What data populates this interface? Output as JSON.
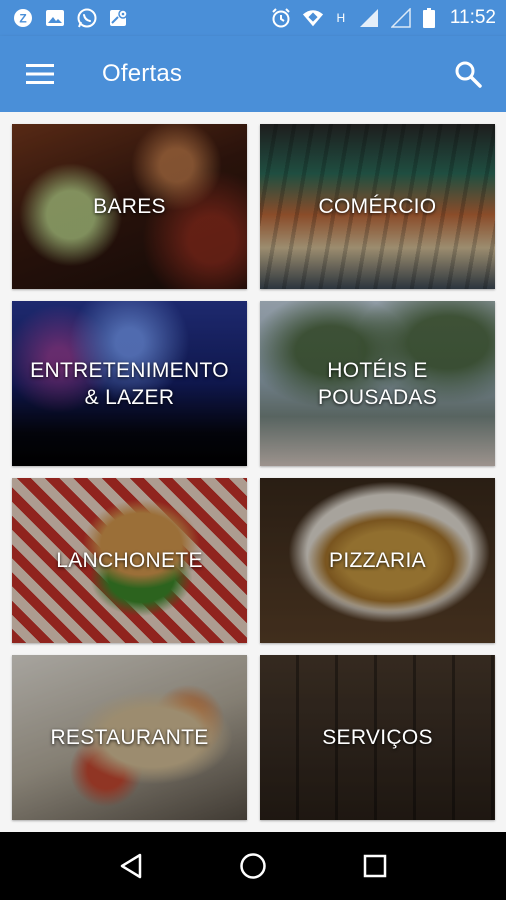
{
  "status_bar": {
    "time": "11:52",
    "left_icons": [
      "zello-icon",
      "gallery-icon",
      "whatsapp-icon",
      "maps-icon"
    ],
    "right_icons": [
      "alarm-icon",
      "wifi-icon",
      "network-h-icon",
      "signal-icon",
      "signal-empty-icon",
      "battery-icon"
    ],
    "network_label": "H"
  },
  "app_bar": {
    "title": "Ofertas",
    "color": "#4a8fd8"
  },
  "categories": [
    {
      "label": "BARES"
    },
    {
      "label": "COMÉRCIO"
    },
    {
      "label": "ENTRETENIMENTO & LAZER"
    },
    {
      "label": "HOTÉIS E POUSADAS"
    },
    {
      "label": "LANCHONETE"
    },
    {
      "label": "PIZZARIA"
    },
    {
      "label": "RESTAURANTE"
    },
    {
      "label": "SERVIÇOS"
    }
  ],
  "nav_bar": {
    "buttons": [
      "back-icon",
      "home-icon",
      "recents-icon"
    ]
  }
}
